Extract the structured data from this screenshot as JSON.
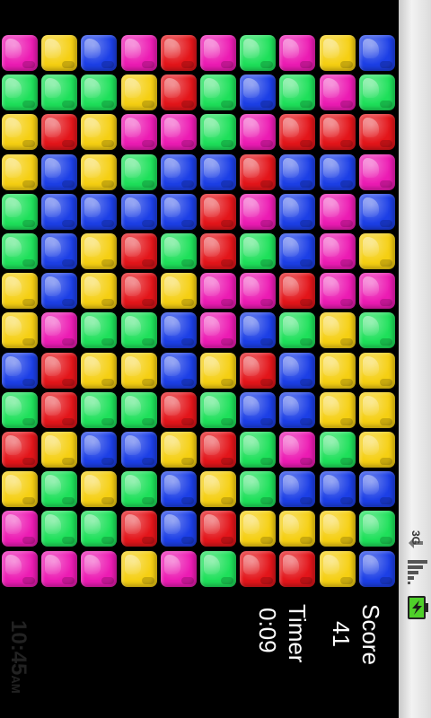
{
  "status_bar": {
    "time": "10:45",
    "ampm": "AM",
    "network_label": "3G"
  },
  "hud": {
    "score_label": "Score",
    "score_value": "41",
    "timer_label": "Timer",
    "timer_value": "0:09"
  },
  "colors": {
    "pink": "#ec1bb3",
    "yellow": "#f5cf12",
    "blue": "#1c3fe6",
    "red": "#e3151a",
    "green": "#1ee05a"
  },
  "board": {
    "rows": [
      [
        "pink",
        "yellow",
        "blue",
        "pink",
        "red",
        "pink",
        "green",
        "pink",
        "yellow",
        "blue"
      ],
      [
        "green",
        "green",
        "green",
        "yellow",
        "red",
        "green",
        "blue",
        "green",
        "pink",
        "green"
      ],
      [
        "yellow",
        "red",
        "yellow",
        "pink",
        "pink",
        "green",
        "pink",
        "red",
        "red",
        "red"
      ],
      [
        "yellow",
        "blue",
        "yellow",
        "green",
        "blue",
        "blue",
        "red",
        "blue",
        "blue",
        "pink"
      ],
      [
        "green",
        "blue",
        "blue",
        "blue",
        "blue",
        "red",
        "pink",
        "blue",
        "pink",
        "blue"
      ],
      [
        "green",
        "blue",
        "yellow",
        "red",
        "green",
        "red",
        "green",
        "blue",
        "pink",
        "yellow"
      ],
      [
        "yellow",
        "blue",
        "yellow",
        "red",
        "yellow",
        "pink",
        "pink",
        "red",
        "pink",
        "pink"
      ],
      [
        "yellow",
        "pink",
        "green",
        "green",
        "blue",
        "pink",
        "blue",
        "green",
        "yellow",
        "green"
      ],
      [
        "blue",
        "red",
        "yellow",
        "yellow",
        "blue",
        "yellow",
        "red",
        "blue",
        "yellow",
        "yellow"
      ],
      [
        "green",
        "red",
        "green",
        "green",
        "red",
        "green",
        "blue",
        "blue",
        "yellow",
        "yellow"
      ],
      [
        "red",
        "yellow",
        "blue",
        "blue",
        "yellow",
        "red",
        "green",
        "pink",
        "green",
        "yellow"
      ],
      [
        "yellow",
        "green",
        "yellow",
        "green",
        "blue",
        "yellow",
        "green",
        "blue",
        "blue",
        "blue"
      ],
      [
        "pink",
        "green",
        "green",
        "red",
        "blue",
        "red",
        "yellow",
        "yellow",
        "yellow",
        "green"
      ],
      [
        "pink",
        "pink",
        "pink",
        "yellow",
        "pink",
        "green",
        "red",
        "red",
        "yellow",
        "blue"
      ]
    ]
  }
}
